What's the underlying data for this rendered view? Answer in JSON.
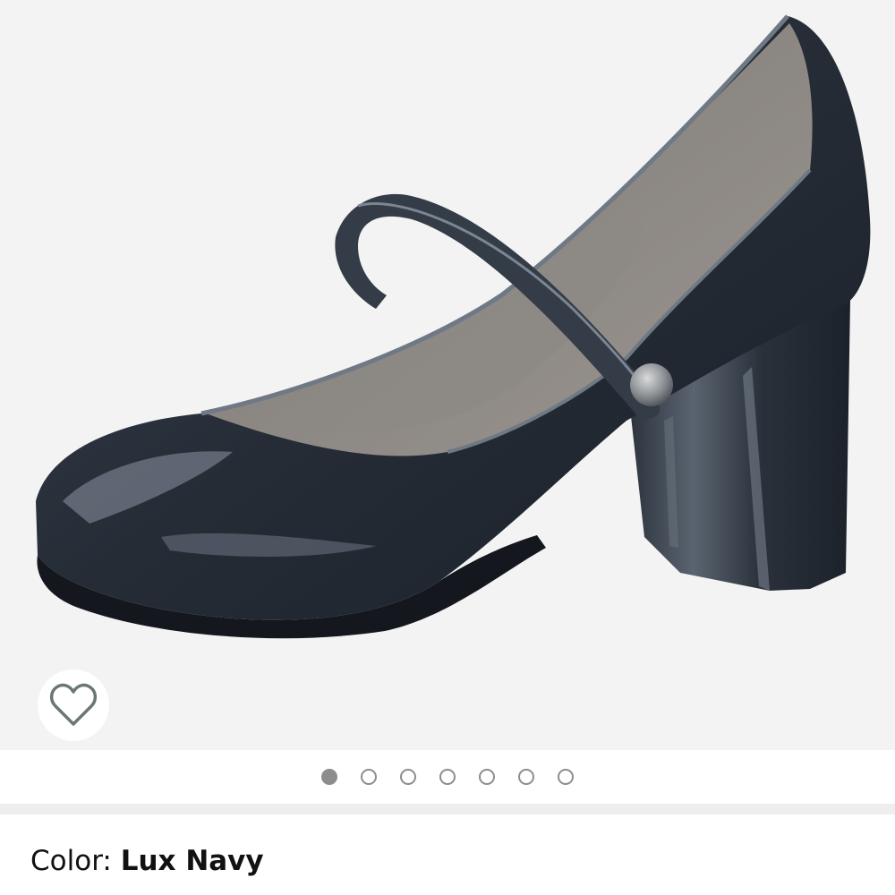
{
  "gallery": {
    "image_name": "shoe-product-image",
    "background_color": "#f3f3f3",
    "wishlist_icon": "heart-outline-icon",
    "pagination": {
      "total": 7,
      "active_index": 0
    }
  },
  "variation": {
    "label": "Color: ",
    "value": "Lux Navy"
  }
}
